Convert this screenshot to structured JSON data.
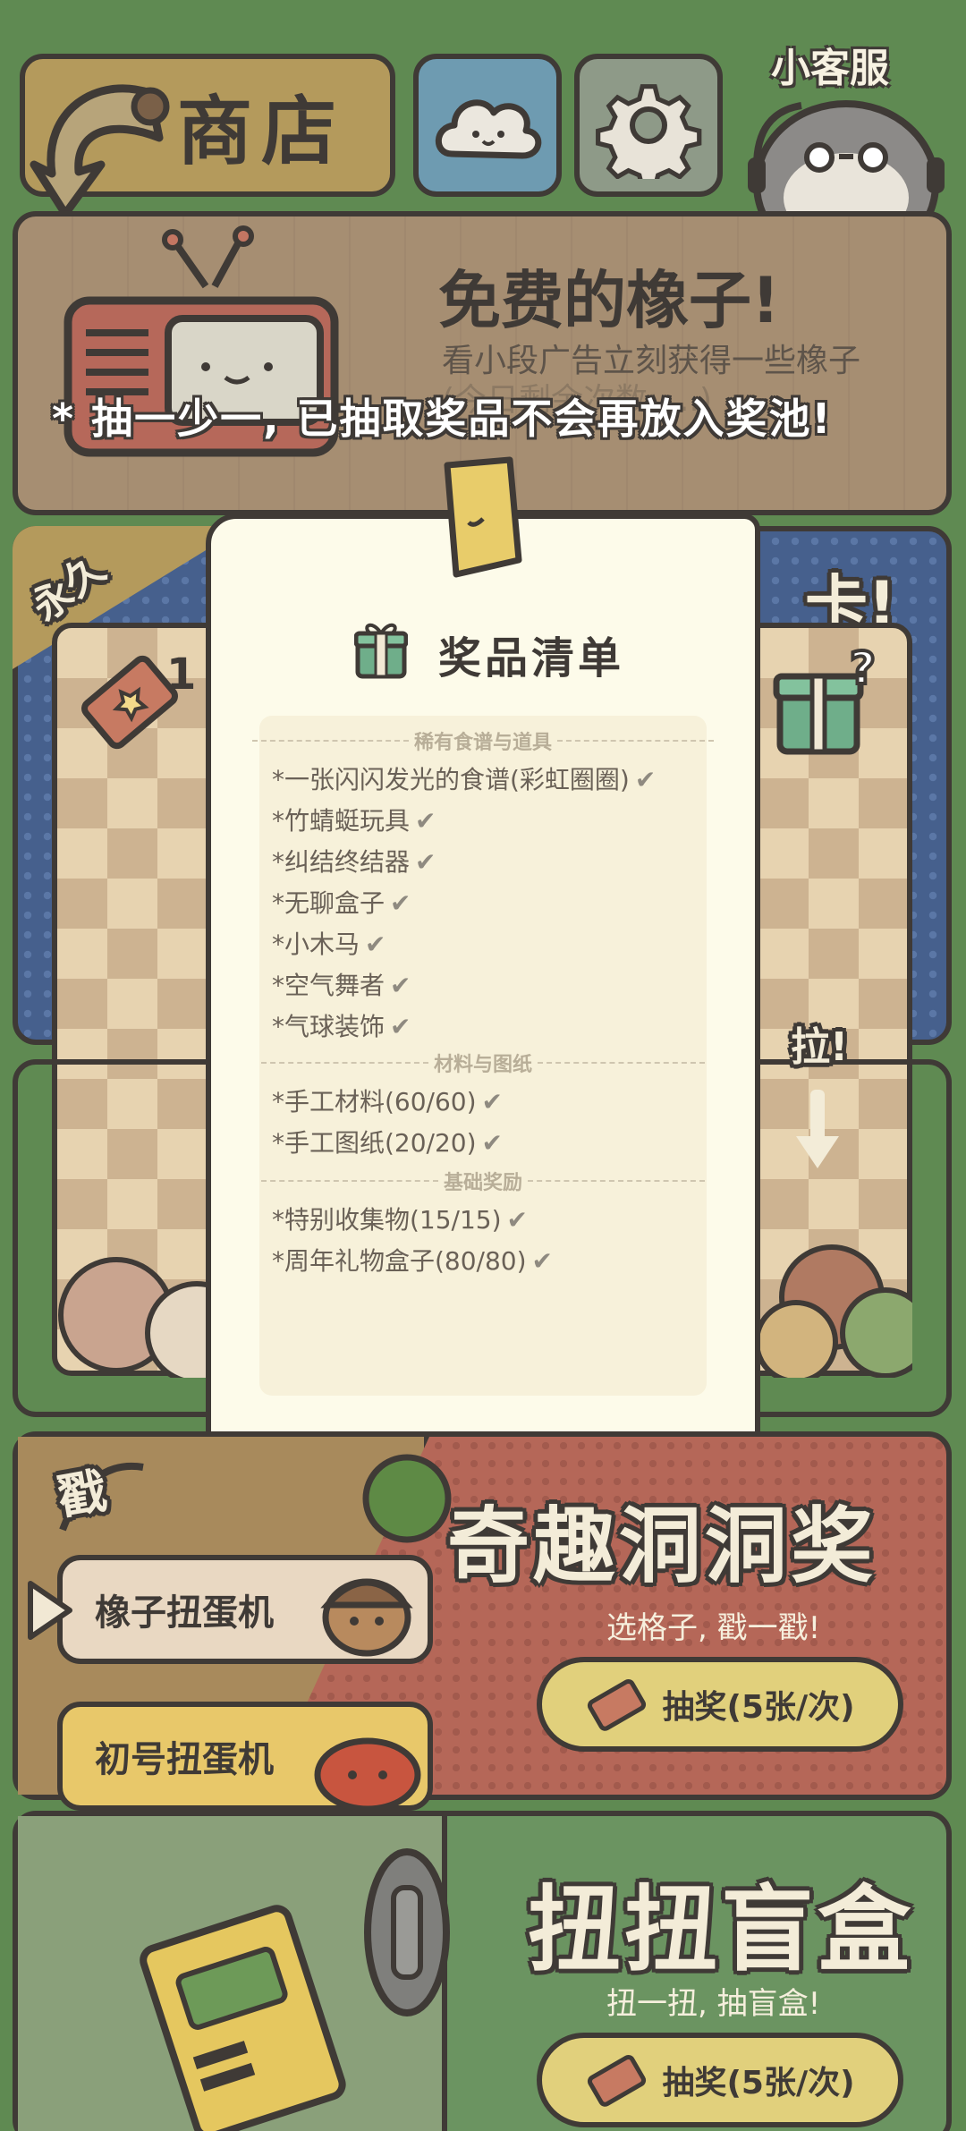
{
  "top_bar": {
    "shop_label": "商店",
    "customer_service_label": "小客服"
  },
  "ad_card": {
    "title": "免费的橡子!",
    "subtitle": "看小段广告立刻获得一些橡子",
    "subtitle_faded": "(今日剩余次数: ...)"
  },
  "banner_note": "* 抽一少一, 已抽取奖品不会再放入奖池!",
  "permanent_card": {
    "ribbon": "永久",
    "title_fragment": "卡!",
    "ticket_count": "1",
    "pull_label": "拉!"
  },
  "prize_list": {
    "title": "奖品清单",
    "sections": [
      {
        "header": "稀有食谱与道具",
        "items": [
          "*一张闪闪发光的食谱(彩虹圈圈)",
          "*竹蜻蜓玩具",
          "*纠结终结器",
          "*无聊盒子",
          "*小木马",
          "*空气舞者",
          "*气球装饰"
        ]
      },
      {
        "header": "材料与图纸",
        "items": [
          "*手工材料(60/60)",
          "*手工图纸(20/20)"
        ]
      },
      {
        "header": "基础奖励",
        "items": [
          "*特别收集物(15/15)",
          "*周年礼物盒子(80/80)"
        ]
      }
    ],
    "check_mark": "✔"
  },
  "hole_prize": {
    "poke_label": "戳",
    "title": "奇趣洞洞奖",
    "subtitle": "选格子, 戳一戳!",
    "draw_button": "抽奖(5张/次)",
    "machine_acorn": "橡子扭蛋机",
    "machine_first": "初号扭蛋机"
  },
  "blind_box": {
    "title": "扭扭盲盒",
    "subtitle": "扭一扭, 抽盲盒!",
    "draw_button": "抽奖(5张/次)"
  },
  "colors": {
    "background": "#5f8a52",
    "outline": "#3f3a36",
    "paper": "#fdfbea",
    "accent_red": "#b56758",
    "accent_blue": "#46608d"
  }
}
